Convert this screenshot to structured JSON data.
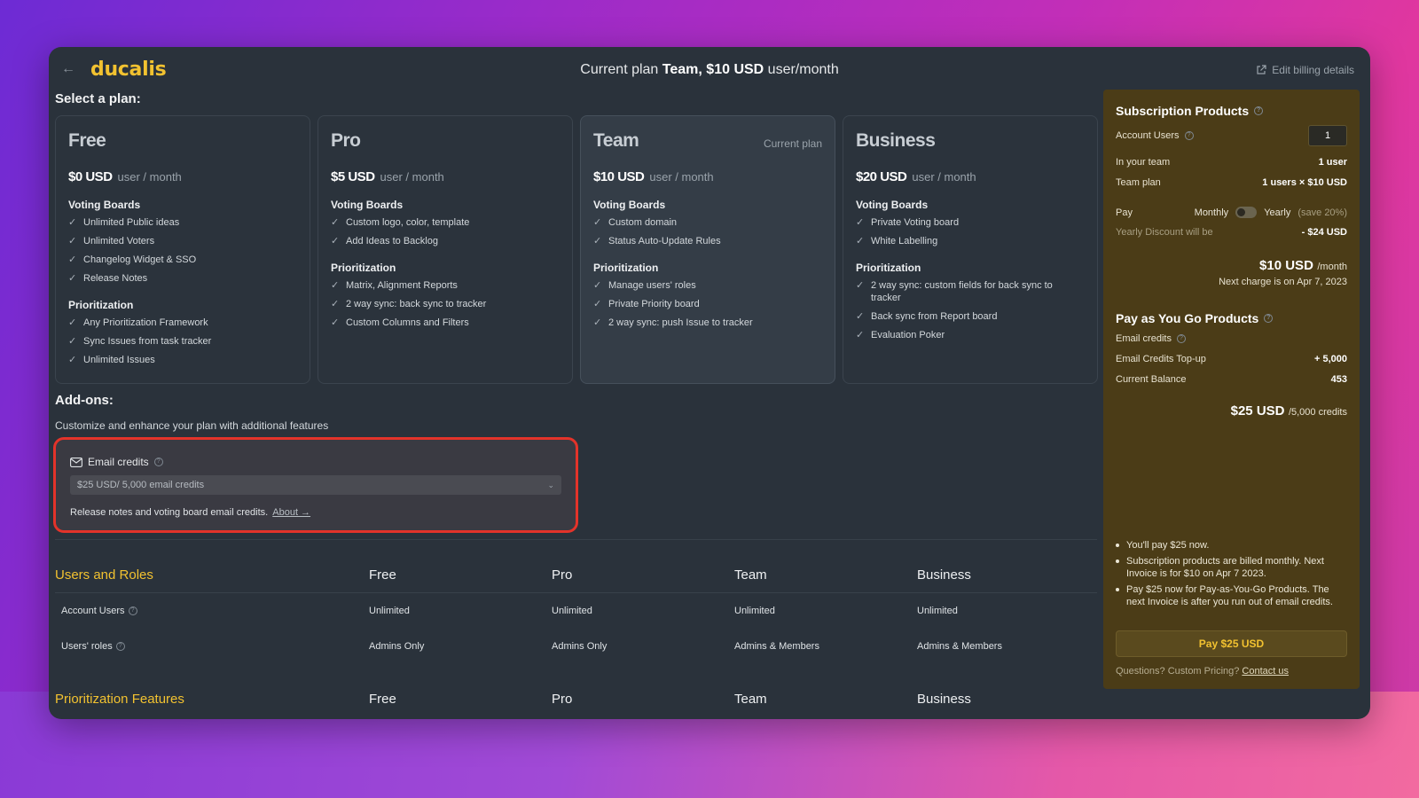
{
  "app": {
    "logo": "ducalis",
    "current_plan_prefix": "Current plan",
    "current_plan_name": "Team",
    "current_plan_price": "$10 USD",
    "current_plan_unit": "user/month",
    "edit_billing": "Edit billing details"
  },
  "plans_section": {
    "title": "Select a plan:",
    "plans": [
      {
        "name": "Free",
        "price": "$0 USD",
        "per": "user / month",
        "tag": "",
        "groups": [
          {
            "title": "Voting Boards",
            "items": [
              "Unlimited Public ideas",
              "Unlimited Voters",
              "Changelog Widget & SSO",
              "Release Notes"
            ]
          },
          {
            "title": "Prioritization",
            "items": [
              "Any Prioritization Framework",
              "Sync Issues from task tracker",
              "Unlimited Issues"
            ]
          }
        ]
      },
      {
        "name": "Pro",
        "price": "$5 USD",
        "per": "user / month",
        "tag": "",
        "groups": [
          {
            "title": "Voting Boards",
            "items": [
              "Custom logo, color, template",
              "Add Ideas to Backlog"
            ]
          },
          {
            "title": "Prioritization",
            "items": [
              "Matrix, Alignment Reports",
              "2 way sync: back sync to tracker",
              "Custom Columns and Filters"
            ]
          }
        ]
      },
      {
        "name": "Team",
        "price": "$10 USD",
        "per": "user / month",
        "tag": "Current plan",
        "groups": [
          {
            "title": "Voting Boards",
            "items": [
              "Custom domain",
              "Status Auto-Update Rules"
            ]
          },
          {
            "title": "Prioritization",
            "items": [
              "Manage users' roles",
              "Private Priority board",
              "2 way sync: push Issue to tracker"
            ]
          }
        ]
      },
      {
        "name": "Business",
        "price": "$20 USD",
        "per": "user / month",
        "tag": "",
        "groups": [
          {
            "title": "Voting Boards",
            "items": [
              "Private Voting board",
              "White Labelling"
            ]
          },
          {
            "title": "Prioritization",
            "items": [
              "2 way sync: custom fields for back sync to tracker",
              "Back sync from Report board",
              "Evaluation Poker"
            ]
          }
        ]
      }
    ]
  },
  "addons": {
    "title": "Add-ons:",
    "subtitle": "Customize and enhance your plan with additional features",
    "email_title": "Email credits",
    "select_value": "$25 USD/ 5,000 email credits",
    "note": "Release notes and voting board email credits.",
    "about_link": "About →"
  },
  "comparison": {
    "section1": {
      "title": "Users and Roles",
      "columns": [
        "Free",
        "Pro",
        "Team",
        "Business"
      ],
      "rows": [
        {
          "label": "Account Users",
          "values": [
            "Unlimited",
            "Unlimited",
            "Unlimited",
            "Unlimited"
          ]
        },
        {
          "label": "Users' roles",
          "values": [
            "Admins Only",
            "Admins Only",
            "Admins & Members",
            "Admins & Members"
          ]
        }
      ]
    },
    "section2": {
      "title": "Prioritization Features",
      "columns": [
        "Free",
        "Pro",
        "Team",
        "Business"
      ]
    }
  },
  "sidebar": {
    "subscription_title": "Subscription Products",
    "account_users_label": "Account Users",
    "account_users_value": "1",
    "in_team_label": "In your team",
    "in_team_value": "1 user",
    "team_plan_label": "Team plan",
    "team_plan_value": "1 users × $10 USD",
    "pay_label": "Pay",
    "monthly": "Monthly",
    "yearly": "Yearly",
    "yearly_save": "(save 20%)",
    "discount_label": "Yearly Discount will be",
    "discount_value": "- $24 USD",
    "sub_total": "$10 USD",
    "sub_per": "/month",
    "next_charge": "Next charge is on Apr 7, 2023",
    "payg_title": "Pay as You Go Products",
    "email_credits_label": "Email credits",
    "topup_label": "Email Credits Top-up",
    "topup_value": "+ 5,000",
    "balance_label": "Current Balance",
    "balance_value": "453",
    "payg_total": "$25 USD",
    "payg_per": "/5,000 credits",
    "bullets": [
      "You'll pay $25 now.",
      "Subscription products are billed monthly. Next Invoice is for $10 on Apr 7 2023.",
      "Pay $25 now for Pay-as-You-Go Products. The next Invoice is after you run out of email credits."
    ],
    "pay_button": "Pay $25 USD",
    "questions": "Questions? Custom Pricing?",
    "contact": "Contact us"
  }
}
